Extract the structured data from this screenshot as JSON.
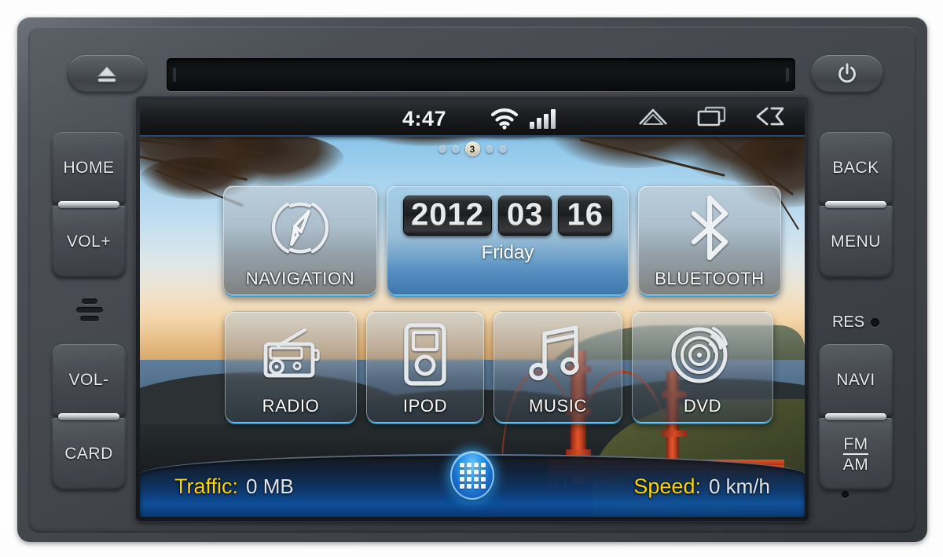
{
  "device": {
    "top_controls": [
      {
        "name": "eject",
        "icon": "eject-icon"
      },
      {
        "name": "disc-slot",
        "icon": "disc-slot"
      },
      {
        "name": "power",
        "icon": "power-icon"
      }
    ],
    "left_buttons": [
      {
        "id": "home",
        "label": "HOME"
      },
      {
        "id": "volume-up",
        "label": "VOL+"
      },
      {
        "id": "volume-down",
        "label": "VOL-"
      },
      {
        "id": "card",
        "label": "CARD"
      }
    ],
    "right_buttons": [
      {
        "id": "back",
        "label": "BACK"
      },
      {
        "id": "menu",
        "label": "MENU"
      },
      {
        "id": "navi",
        "label": "NAVI"
      },
      {
        "id": "fm-am",
        "label": "FM",
        "label2": "AM"
      }
    ],
    "reset": {
      "label": "RES"
    }
  },
  "screen": {
    "statusbar": {
      "time": "4:47",
      "wifi_icon": "wifi-icon",
      "signal_icon": "signal-bars-icon",
      "signal_bars": 4,
      "nav_icons": [
        {
          "id": "home",
          "icon": "home-icon"
        },
        {
          "id": "recents",
          "icon": "recent-apps-icon"
        },
        {
          "id": "back",
          "icon": "back-icon"
        }
      ]
    },
    "page_indicator": {
      "total": 5,
      "current": 3,
      "current_label": "3"
    },
    "tiles": [
      {
        "id": "navigation",
        "label": "NAVIGATION",
        "icon": "compass-icon"
      },
      {
        "id": "bluetooth",
        "label": "BLUETOOTH",
        "icon": "bluetooth-icon"
      },
      {
        "id": "radio",
        "label": "RADIO",
        "icon": "radio-icon"
      },
      {
        "id": "ipod",
        "label": "IPOD",
        "icon": "ipod-icon"
      },
      {
        "id": "music",
        "label": "MUSIC",
        "icon": "music-note-icon"
      },
      {
        "id": "dvd",
        "label": "DVD",
        "icon": "disc-icon"
      }
    ],
    "date_widget": {
      "year": "2012",
      "month": "03",
      "day": "16",
      "weekday": "Friday"
    },
    "dock": {
      "traffic_label": "Traffic:",
      "traffic_value": "0 MB",
      "speed_label": "Speed:",
      "speed_value": "0 km/h",
      "apps_button_icon": "app-drawer-grid-icon"
    }
  },
  "colors": {
    "accent_blue": "#28a0e6",
    "label_yellow": "#ffd400",
    "bezel_dark": "#3c4045",
    "status_bar": "#1b1d20"
  }
}
